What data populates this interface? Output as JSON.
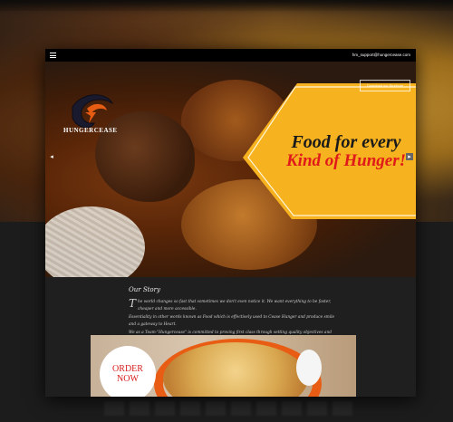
{
  "header": {
    "email": "hm_support@hungercease.com"
  },
  "hero": {
    "brand_name": "HUNGERCEASE",
    "download_button": "Download our Brochure",
    "headline_line1": "Food for every",
    "headline_line2": "Kind of Hunger!",
    "prev_arrow": "◂",
    "next_arrow": "▸"
  },
  "story": {
    "title": "Our Story",
    "paragraphs": [
      "The world changes so fast that sometimes we don't even notice it. We want everything to be faster, cheaper and more accessible.",
      "Essentiality in other words known as Food which is effectively used to Cease Hunger and produce smile and a gateway to Heart.",
      "We as a Team-\"Hungercease\" is committed to proving first class through setting quality objectives and targets in all areas of our operation including food production and delivery with respect to food safety with the aim of continually improving our service performance, which is regularly monitored and measured by management to deliver improved customer services."
    ]
  },
  "promo": {
    "order_line1": "ORDER",
    "order_line2": "NOW"
  },
  "colors": {
    "accent_yellow": "#f6b21f",
    "headline_red": "#e01a1a",
    "bowl_orange": "#e85c13"
  }
}
